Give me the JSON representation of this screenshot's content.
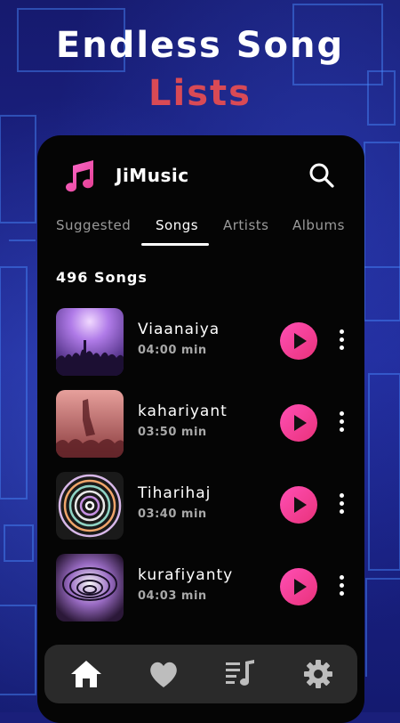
{
  "promo": {
    "line1": "Endless Song",
    "line2": "Lists"
  },
  "app": {
    "title": "JiMusic"
  },
  "tabs": [
    {
      "label": "Suggested",
      "active": false
    },
    {
      "label": "Songs",
      "active": true
    },
    {
      "label": "Artists",
      "active": false
    },
    {
      "label": "Albums",
      "active": false
    }
  ],
  "songs_count": "496 Songs",
  "songs": [
    {
      "title": "Viaanaiya",
      "duration": "04:00 min"
    },
    {
      "title": "kahariyant",
      "duration": "03:50 min"
    },
    {
      "title": "Tiharihaj",
      "duration": "03:40 min"
    },
    {
      "title": "kurafiyanty",
      "duration": "04:03 min"
    }
  ],
  "nav": {
    "icons": [
      "home-icon",
      "heart-icon",
      "playlist-icon",
      "gear-icon"
    ]
  },
  "colors": {
    "accent": "#ff4fb5",
    "headline_secondary": "#d94a55",
    "background": "#1a1f7a",
    "card": "#050505"
  }
}
